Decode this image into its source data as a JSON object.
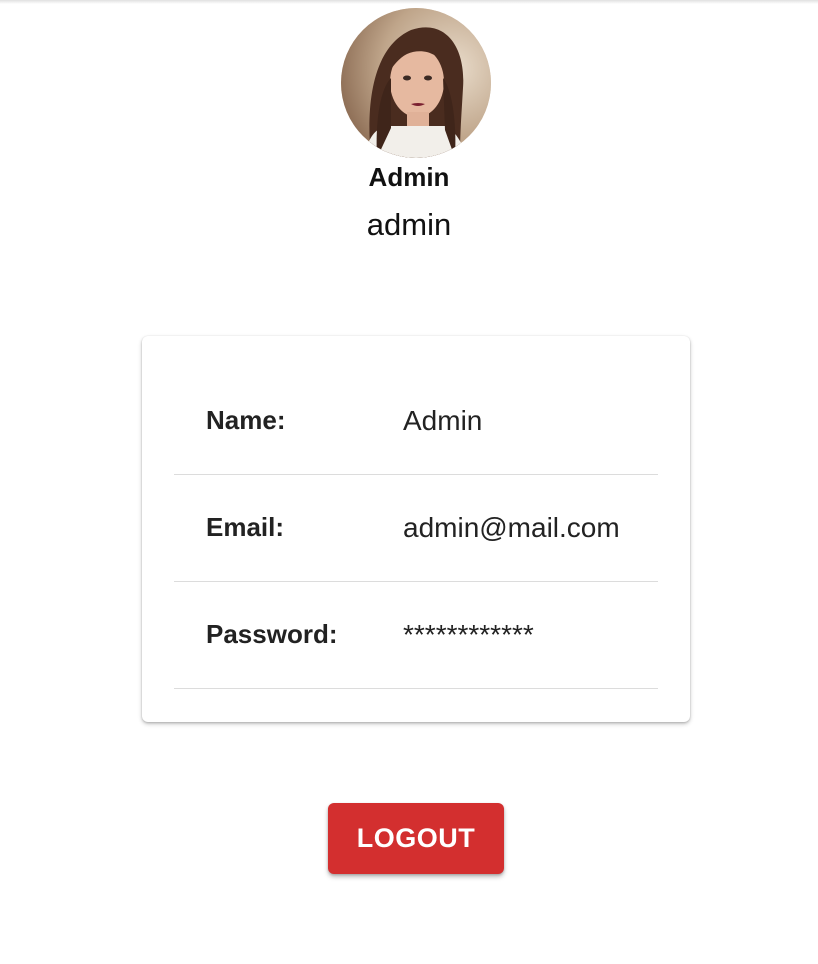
{
  "profile": {
    "display_name": "Admin",
    "username": "admin",
    "avatar_icon": "user-photo"
  },
  "details": {
    "rows": [
      {
        "label": "Name:",
        "value": "Admin"
      },
      {
        "label": "Email:",
        "value": "admin@mail.com"
      },
      {
        "label": "Password:",
        "value": "************"
      }
    ]
  },
  "actions": {
    "logout_label": "LOGOUT",
    "logout_color": "#d32f2f"
  }
}
